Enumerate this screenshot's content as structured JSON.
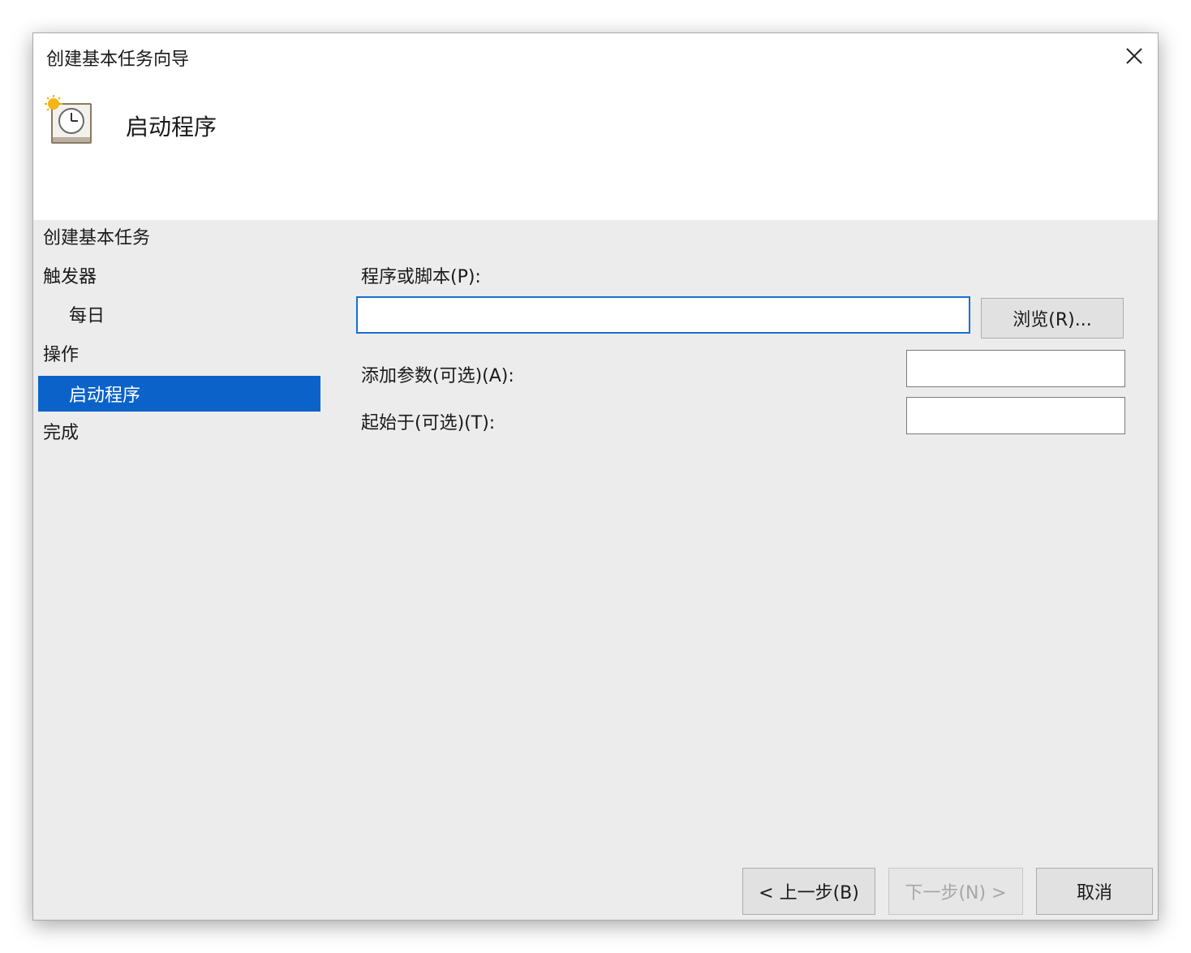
{
  "window": {
    "title": "创建基本任务向导",
    "heading": "启动程序"
  },
  "nav": {
    "items": [
      {
        "label": "创建基本任务",
        "indent": false,
        "selected": false
      },
      {
        "label": "触发器",
        "indent": false,
        "selected": false
      },
      {
        "label": "每日",
        "indent": true,
        "selected": false
      },
      {
        "label": "操作",
        "indent": false,
        "selected": false
      },
      {
        "label": "启动程序",
        "indent": true,
        "selected": true
      },
      {
        "label": "完成",
        "indent": false,
        "selected": false
      }
    ]
  },
  "form": {
    "program_label": "程序或脚本(P):",
    "program_value": "",
    "browse_label": "浏览(R)...",
    "args_label": "添加参数(可选)(A):",
    "args_value": "",
    "start_in_label": "起始于(可选)(T):",
    "start_in_value": ""
  },
  "footer": {
    "back_label": "< 上一步(B)",
    "next_label": "下一步(N) >",
    "cancel_label": "取消"
  },
  "colors": {
    "selection": "#0b63c9",
    "focus_border": "#1a6fd1",
    "dialog_bg": "#ececec"
  }
}
